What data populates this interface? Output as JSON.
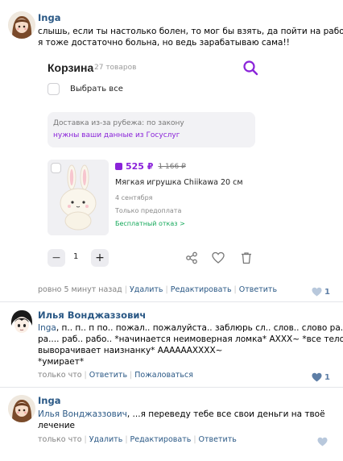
{
  "comments": [
    {
      "author": "Inga",
      "lines": [
        "слышь, если ты настолько болен, то мог бы взять, да пойти на работу!",
        "я тоже достаточно больна, но ведь зарабатываю сама!!"
      ],
      "time": "ровно 5 минут назад",
      "actions": [
        "Удалить",
        "Редактировать",
        "Ответить"
      ],
      "likes": "1"
    },
    {
      "author": "Илья Вонджаззович",
      "mention": "Inga",
      "lines": [
        ", п.. п.. п по.. пожал.. пожалуйста.. заблюрь сл.. слов.. слово ра..",
        "ра.... раб.. рабо.. *начинается неимоверная ломка* АХХХ~ *все тело",
        "выворачивает наизнанку* АААААAXXXX~",
        "*умирает*"
      ],
      "time": "только что",
      "actions": [
        "Ответить",
        "Пожаловаться"
      ],
      "likes": "1"
    },
    {
      "author": "Inga",
      "mention": "Илья Вонджаззович",
      "lines": [
        ", ...я переведу тебе все свои деньги на твоё",
        "лечение"
      ],
      "time": "только что",
      "actions": [
        "Удалить",
        "Редактировать",
        "Ответить"
      ],
      "likes": ""
    }
  ],
  "cart": {
    "title": "Корзина",
    "count": "27 товаров",
    "select_all": "Выбрать все",
    "delivery_title": "Доставка из-за рубежа: по закону",
    "delivery_link": "нужны ваши данные из Госуслуг",
    "price": "525 ₽",
    "old_price": "1 166 ₽",
    "product_name": "Мягкая игрушка Chiikawa 20 см",
    "date": "4 сентября",
    "prepay": "Только предоплата",
    "refund": "Бесплатный отказ >",
    "quantity": "1",
    "minus": "−",
    "plus": "+"
  },
  "icons": {
    "search": "search-icon",
    "share": "share-icon",
    "favorite": "heart-icon",
    "delete": "trash-icon",
    "like": "like-heart-icon"
  },
  "colors": {
    "link": "#2a5885",
    "meta": "#828282",
    "brand": "#8a23d9",
    "refund": "#14a85a",
    "like": "#5d7ea6",
    "like_inactive": "#b8c8dc"
  }
}
